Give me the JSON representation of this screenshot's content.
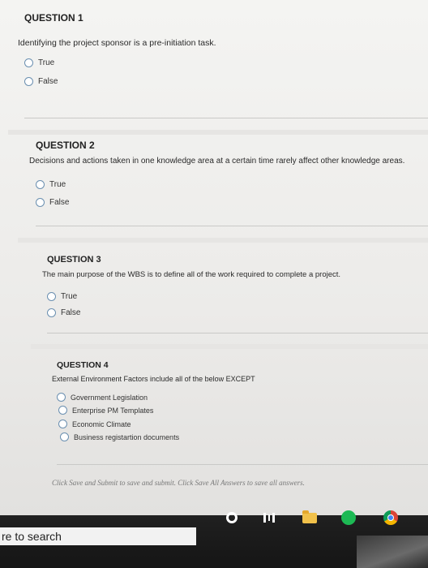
{
  "questions": [
    {
      "heading": "QUESTION 1",
      "text": "Identifying the project sponsor is a pre-initiation task.",
      "options": [
        "True",
        "False"
      ]
    },
    {
      "heading": "QUESTION 2",
      "text": "Decisions and actions taken in one knowledge area at a certain time rarely affect other knowledge areas.",
      "options": [
        "True",
        "False"
      ]
    },
    {
      "heading": "QUESTION 3",
      "text": "The main purpose of the WBS is to define all of the work required to complete a project.",
      "options": [
        "True",
        "False"
      ]
    },
    {
      "heading": "QUESTION 4",
      "text": "External Environment Factors include all of the below EXCEPT",
      "options": [
        "Government Legislation",
        "Enterprise PM Templates",
        "Economic Climate",
        "Business registartion documents"
      ]
    }
  ],
  "footer": {
    "note": "Click Save and Submit to save and submit. Click Save All Answers to save all answers."
  },
  "taskbar": {
    "search_label": "re to search",
    "icons": [
      "cortana-icon",
      "task-view-icon",
      "file-explorer-icon",
      "spotify-icon",
      "chrome-icon"
    ]
  }
}
